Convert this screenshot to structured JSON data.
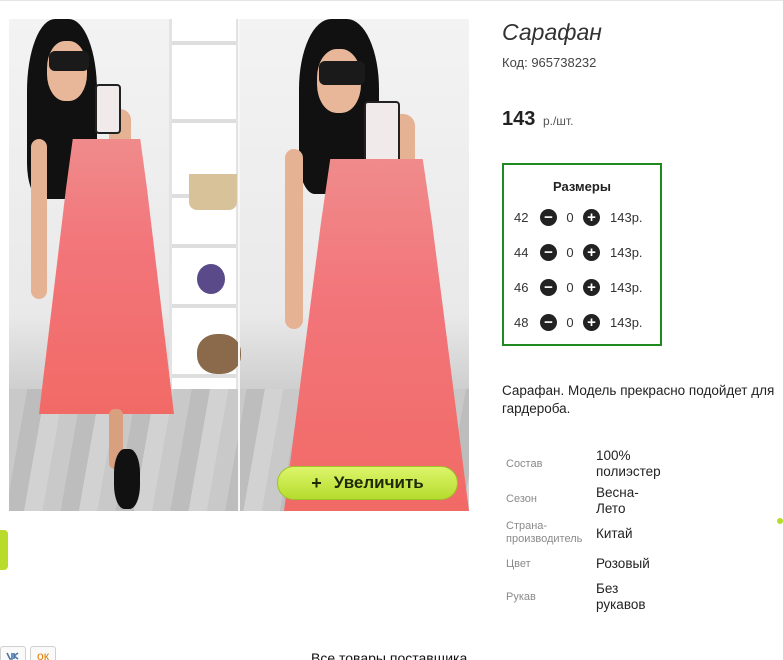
{
  "product": {
    "title": "Сарафан",
    "code": "Код: 965738232",
    "price": "143",
    "price_unit": "р./шт.",
    "zoom_button": "Увеличить",
    "zoom_plus": "+"
  },
  "sizes": {
    "heading": "Размеры",
    "rows": [
      {
        "size": "42",
        "qty": "0",
        "price": "143р."
      },
      {
        "size": "44",
        "qty": "0",
        "price": "143р."
      },
      {
        "size": "46",
        "qty": "0",
        "price": "143р."
      },
      {
        "size": "48",
        "qty": "0",
        "price": "143р."
      }
    ],
    "minus": "−",
    "plus": "+"
  },
  "description": {
    "line1": "Сарафан. Модель прекрасно подойдет для",
    "line2": "гардероба."
  },
  "specs": [
    {
      "label": "Состав",
      "value": "100% полиэстер"
    },
    {
      "label": "Сезон",
      "value": "Весна-Лето"
    },
    {
      "label": "Страна-производитель",
      "value": "Китай"
    },
    {
      "label": "Цвет",
      "value": "Розовый"
    },
    {
      "label": "Рукав",
      "value": "Без рукавов"
    }
  ],
  "footer": {
    "supplier_link": "Все товары поставщика",
    "icons": [
      "vk-icon",
      "odnoklassniki-icon"
    ],
    "ok_glyph": "ок"
  },
  "colors": {
    "accent_green": "#b6dc2e",
    "sizes_border": "#1f8a1f",
    "dress": "#f26a66"
  }
}
